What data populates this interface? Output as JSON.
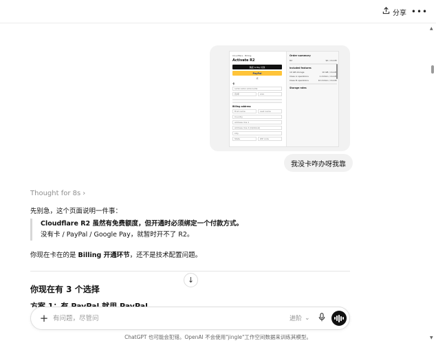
{
  "topbar": {
    "share_label": "分享",
    "share_icon": "share-icon",
    "more_icon": "more-icon"
  },
  "attachment": {
    "left": {
      "brand": "Cloudflare · Billing",
      "title": "Activate R2",
      "gpay_label": "购买 G Pay 付款",
      "paypal_label": "PayPal",
      "or_label": "或",
      "card_label": "卡",
      "card_number": "1234 1234 1234 1234",
      "expiry_label": "有效期",
      "expiry_placeholder": "月/年",
      "cvc_label": "CVC",
      "billing_label": "Billing address",
      "first_name": "First name",
      "last_name": "Last name",
      "country": "Country",
      "address1": "Address line 1",
      "address2": "Address line 2 (Optional)",
      "city": "City",
      "state": "State",
      "zip": "ZIP code"
    },
    "right": {
      "title": "Order summary",
      "plan_name": "R2",
      "plan_price": "$0 / month",
      "included_label": "Included features",
      "features": [
        {
          "name": "10 GB storage",
          "value": "10 GB / month"
        },
        {
          "name": "Class A operations",
          "value": "1 million / month"
        },
        {
          "name": "Class B operations",
          "value": "10 million / month"
        }
      ],
      "storage_label": "Storage rates"
    }
  },
  "user_message": "我没卡咋办呀我靠",
  "assistant": {
    "thought": "Thought for 8s",
    "intro": "先别急，这个页面说明一件事：",
    "quote_bold": "Cloudflare R2 虽然有免费额度，但开通时必须绑定一个付款方式。",
    "quote_normal": "没有卡 / PayPal / Google Pay，就暂时开不了 R2。",
    "p2_before": "你现在卡在的是 ",
    "p2_bold": "Billing 开通环节",
    "p2_after": "，还不是技术配置问题。",
    "heading": "你现在有 3 个选择",
    "option1": "方案 1：有 PayPal 就用 PayPal"
  },
  "composer": {
    "placeholder": "有问题，尽管问",
    "model_label": "进阶",
    "plus_icon": "plus-icon",
    "mic_icon": "microphone-icon",
    "voice_icon": "voice-mode-icon"
  },
  "footer": "ChatGPT 也可能会犯错。OpenAI 不会使用\"jingle\"工作空间数据来训练其模型。"
}
